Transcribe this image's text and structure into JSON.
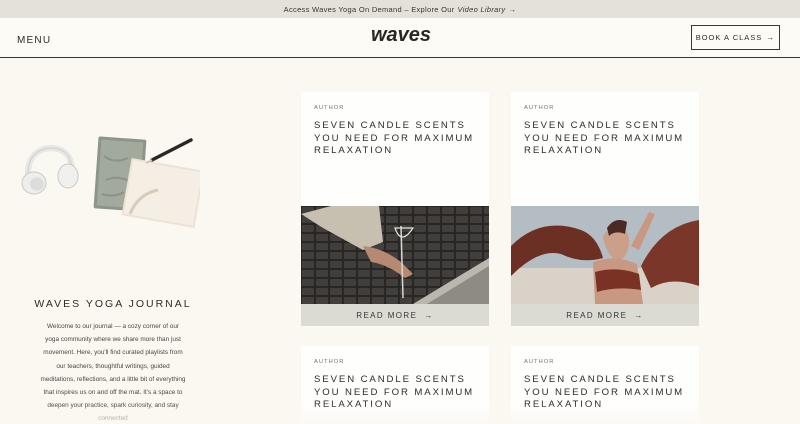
{
  "announcement": {
    "text": "Access Waves Yoga On Demand – Explore Our",
    "link": "Video Library",
    "arrow": "→"
  },
  "header": {
    "menu_label": "MENU",
    "logo_text": "waves",
    "book_label": "BOOK A CLASS",
    "book_arrow": "→"
  },
  "journal": {
    "title": "WAVES YOGA JOURNAL",
    "intro": "Welcome to our journal — a cozy corner of our yoga community where we share more than just movement. Here, you'll find curated playlists from our teachers, thoughtful writings, guided meditations, reflections, and a little bit of everything that inspires us on and off the mat. It's a space to deepen your practice, spark curiosity, and stay connected"
  },
  "posts": [
    {
      "author": "AUTHOR",
      "title": "SEVEN CANDLE SCENTS YOU NEED FOR MAXIMUM RELAXATION",
      "read_more": "READ MORE",
      "arrow": "→"
    },
    {
      "author": "AUTHOR",
      "title": "SEVEN CANDLE SCENTS YOU NEED FOR MAXIMUM RELAXATION",
      "read_more": "READ MORE",
      "arrow": "→"
    },
    {
      "author": "AUTHOR",
      "title": "SEVEN CANDLE SCENTS YOU NEED FOR MAXIMUM RELAXATION"
    },
    {
      "author": "AUTHOR",
      "title": "SEVEN CANDLE SCENTS YOU NEED FOR MAXIMUM RELAXATION"
    }
  ],
  "colors": {
    "background": "#fbf8f1",
    "announcement_bg": "#e3e1d9",
    "read_more_bg": "#dcdbd3",
    "text": "#2f2b26"
  }
}
